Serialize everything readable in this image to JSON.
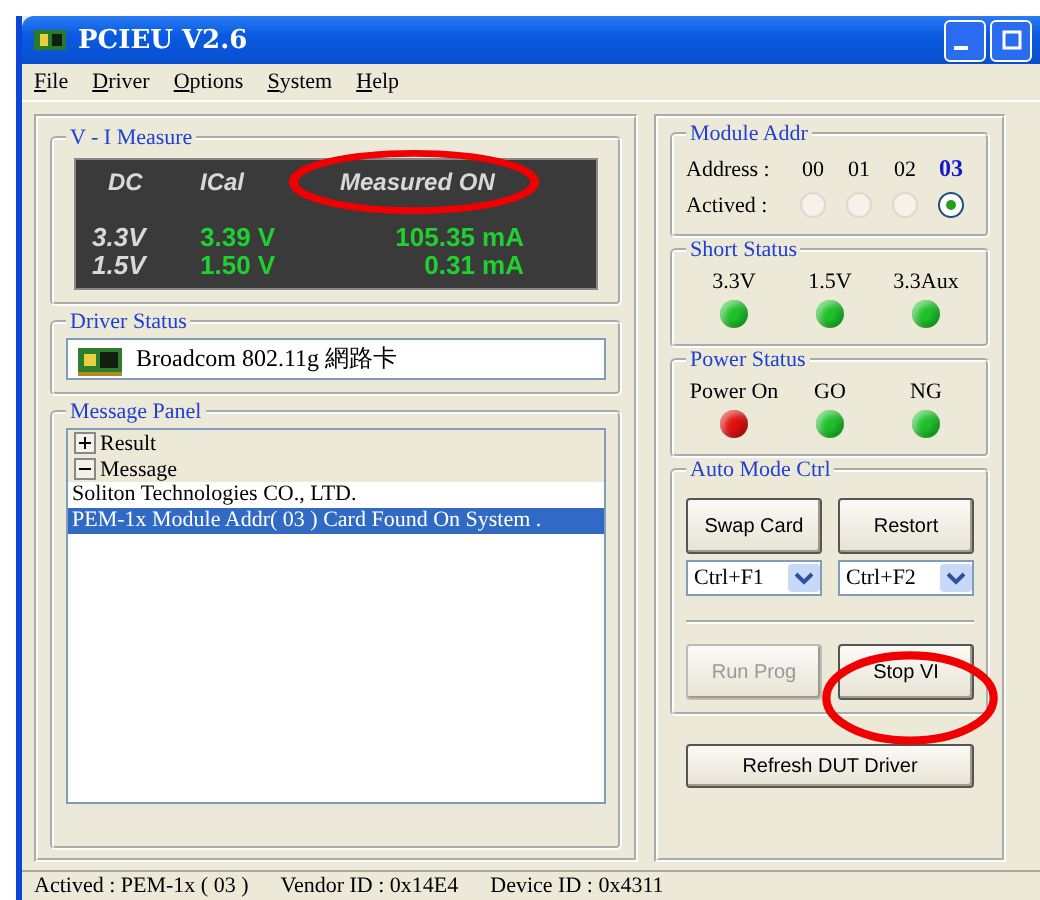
{
  "window": {
    "title": "PCIEU  V2.6"
  },
  "menu": [
    "File",
    "Driver",
    "Options",
    "System",
    "Help"
  ],
  "vi_measure": {
    "title": "V - I  Measure",
    "headers": [
      "DC",
      "ICal",
      "Measured  ON"
    ],
    "rows": [
      [
        "3.3V",
        "3.39 V",
        "105.35 mA"
      ],
      [
        "1.5V",
        "1.50 V",
        "0.31 mA"
      ]
    ]
  },
  "driver_status": {
    "title": "Driver  Status",
    "text": "Broadcom 802.11g 網路卡"
  },
  "message_panel": {
    "title": "Message Panel",
    "items": [
      {
        "kind": "group",
        "label": "Result",
        "expanded": false
      },
      {
        "kind": "group",
        "label": "Message",
        "expanded": true
      },
      {
        "kind": "line",
        "text": "Soliton Technologies CO., LTD.",
        "selected": false
      },
      {
        "kind": "line",
        "text": "PEM-1x  Module Addr( 03 ) Card Found On System .",
        "selected": true
      }
    ]
  },
  "module_addr": {
    "title": "Module Addr",
    "address_label": "Address :",
    "actived_label": "Actived :",
    "addresses": [
      {
        "label": "00",
        "selected": false
      },
      {
        "label": "01",
        "selected": false
      },
      {
        "label": "02",
        "selected": false
      },
      {
        "label": "03",
        "selected": true
      }
    ]
  },
  "short_status": {
    "title": "Short  Status",
    "leds": [
      {
        "label": "3.3V",
        "color": "#1fc02a"
      },
      {
        "label": "1.5V",
        "color": "#1fc02a"
      },
      {
        "label": "3.3Aux",
        "color": "#1fc02a"
      }
    ]
  },
  "power_status": {
    "title": "Power  Status",
    "leds": [
      {
        "label": "Power On",
        "color": "#e01010"
      },
      {
        "label": "GO",
        "color": "#1fc02a"
      },
      {
        "label": "NG",
        "color": "#1fc02a"
      }
    ]
  },
  "auto_mode": {
    "title": "Auto Mode Ctrl",
    "buttons": [
      {
        "label": "Swap Card",
        "hotkey": "Ctrl+F1"
      },
      {
        "label": "Restort",
        "hotkey": "Ctrl+F2"
      }
    ],
    "actions": [
      {
        "label": "Run Prog",
        "disabled": true
      },
      {
        "label": "Stop VI",
        "disabled": false
      }
    ]
  },
  "refresh_button": "Refresh  DUT Driver",
  "status_bar": [
    "Actived :  PEM-1x ( 03 )",
    "Vendor ID : 0x14E4",
    "Device ID : 0x4311"
  ]
}
